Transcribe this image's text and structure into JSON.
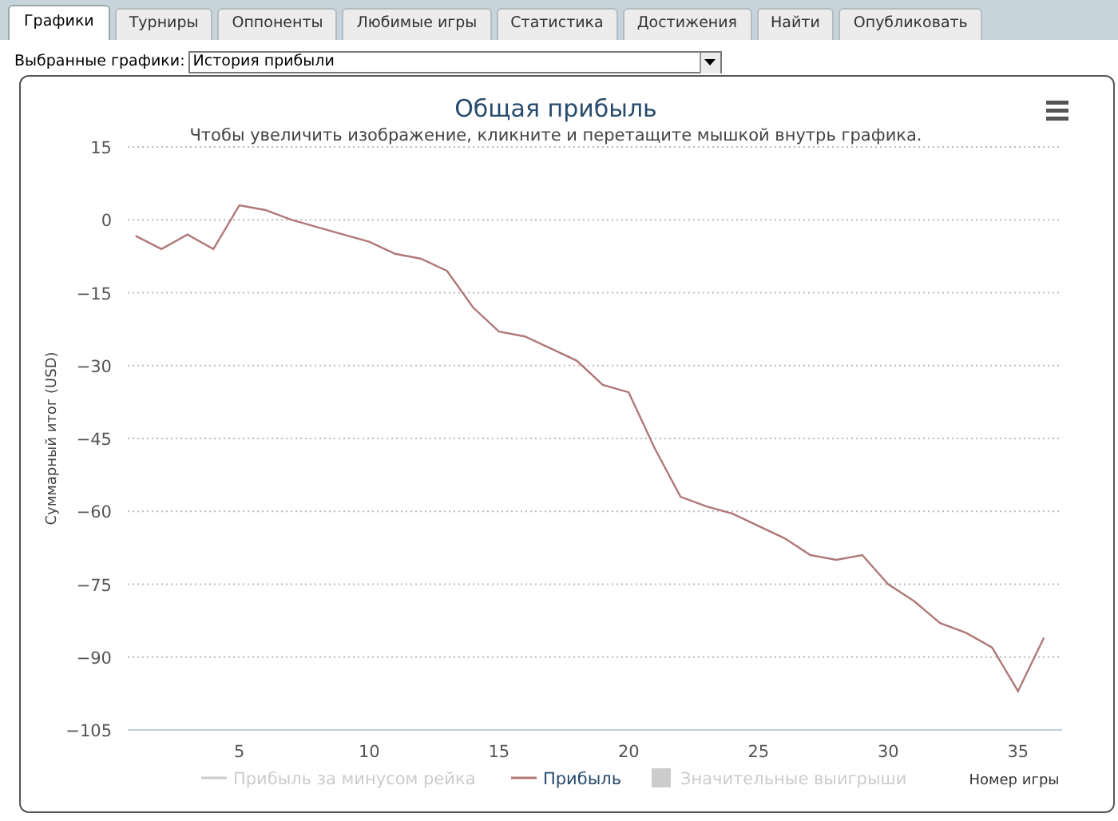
{
  "tabs": [
    {
      "label": "Графики",
      "selected": true
    },
    {
      "label": "Турниры",
      "selected": false
    },
    {
      "label": "Оппоненты",
      "selected": false
    },
    {
      "label": "Любимые игры",
      "selected": false
    },
    {
      "label": "Статистика",
      "selected": false
    },
    {
      "label": "Достижения",
      "selected": false
    },
    {
      "label": "Найти",
      "selected": false
    },
    {
      "label": "Опубликовать",
      "selected": false
    }
  ],
  "chart_selector": {
    "label": "Выбранные графики:",
    "value": "История прибыли"
  },
  "chart": {
    "subtitle": "Чтобы увеличить изображение, кликните и перетащите мышкой внутрь графика.",
    "legend": [
      {
        "label": "Прибыль за минусом рейка",
        "kind": "line",
        "visible": false
      },
      {
        "kind": "series",
        "visible": true
      },
      {
        "label": "Значительные выигрыши",
        "kind": "area",
        "visible": false
      }
    ],
    "chart_data": {
      "type": "line",
      "grid": true,
      "title": "Общая прибыль",
      "xlabel": "Номер игры",
      "ylabel": "Суммарный итог (USD)",
      "x": [
        1,
        2,
        3,
        4,
        5,
        6,
        7,
        8,
        9,
        10,
        11,
        12,
        13,
        14,
        15,
        16,
        17,
        18,
        19,
        20,
        21,
        22,
        23,
        24,
        25,
        26,
        27,
        28,
        29,
        30,
        31,
        32,
        33,
        34,
        35,
        36
      ],
      "series": [
        {
          "name": "Прибыль",
          "color": "#b07878",
          "values": [
            -3.3,
            -6,
            -3,
            -6,
            3,
            2,
            0,
            -1.5,
            -3,
            -4.5,
            -7,
            -8,
            -10.5,
            -18,
            -23,
            -24,
            -26.5,
            -29,
            -34,
            -35.5,
            -47,
            -57,
            -59,
            -60.5,
            -63,
            -65.5,
            -69,
            -70,
            -69,
            -75,
            -78.5,
            -83,
            -85,
            -88,
            -97,
            -86
          ]
        }
      ],
      "xlim": [
        0.7,
        36.7
      ],
      "ylim": [
        -105,
        15
      ],
      "xticks": [
        5,
        10,
        15,
        20,
        25,
        30,
        35
      ],
      "yticks": [
        15,
        0,
        -15,
        -30,
        -45,
        -60,
        -75,
        -90,
        -105
      ]
    }
  }
}
